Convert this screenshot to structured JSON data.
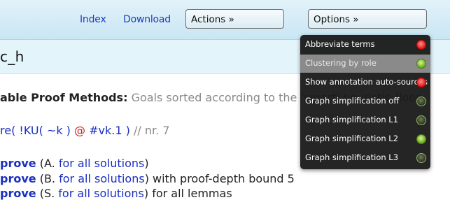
{
  "nav": {
    "index": "Index",
    "download": "Download",
    "actions": "Actions »",
    "options": "Options »"
  },
  "page_title": "c_h",
  "proof_methods": {
    "label": "able Proof Methods:",
    "description": "Goals sorted according to the 'smart' heuristic (loop"
  },
  "rule_line": {
    "prefix": "re(",
    "content": "!KU( ~k )",
    "at": "@",
    "var": "#vk.1",
    "close": ")",
    "comment": "// nr. 7"
  },
  "autoprove_lines": [
    {
      "keyword": "prove",
      "paren_open": "(A.",
      "link": "for all solutions",
      "rest": ")"
    },
    {
      "keyword": "prove",
      "paren_open": "(B.",
      "link": "for all solutions",
      "rest": ") with proof-depth bound 5"
    },
    {
      "keyword": "prove",
      "paren_open": "(S.",
      "link": "for all solutions",
      "rest": ") for all lemmas"
    }
  ],
  "options_menu": [
    {
      "label": "Abbreviate terms",
      "state": "red",
      "active": false
    },
    {
      "label": "Clustering by role",
      "state": "green",
      "active": true
    },
    {
      "label": "Show annotation auto-sources",
      "state": "red",
      "active": false
    },
    {
      "label": "Graph simplification off",
      "state": "dark",
      "active": false
    },
    {
      "label": "Graph simplification L1",
      "state": "dark",
      "active": false
    },
    {
      "label": "Graph simplification L2",
      "state": "green",
      "active": false
    },
    {
      "label": "Graph simplification L3",
      "state": "dark",
      "active": false
    }
  ],
  "colors": {
    "link_blue": "#1a2fc0",
    "menu_bg": "#121212",
    "header_bg": "#c9e6f3"
  }
}
